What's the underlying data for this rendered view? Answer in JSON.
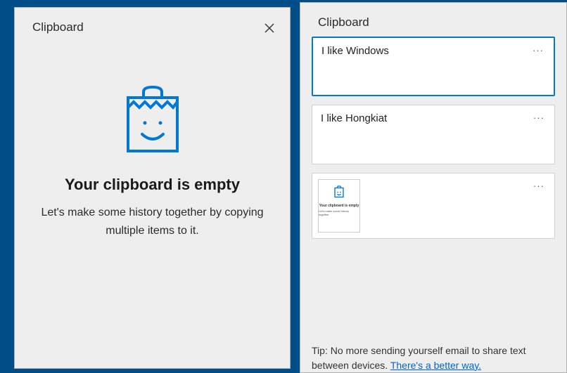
{
  "leftPanel": {
    "title": "Clipboard",
    "iconName": "clipboard-smile-icon",
    "emptyHeading": "Your clipboard is empty",
    "emptySub": "Let's make some history together by copying multiple items to it."
  },
  "rightPanel": {
    "title": "Clipboard",
    "items": [
      {
        "type": "text",
        "content": "I like Windows",
        "selected": true
      },
      {
        "type": "text",
        "content": "I like Hongkiat",
        "selected": false
      },
      {
        "type": "image",
        "thumbTitle": "Your clipboard is empty",
        "thumbSub": "Let's make some history together",
        "selected": false
      }
    ],
    "tipPrefix": "Tip: No more sending yourself email to share text between devices.  ",
    "tipLink": "There's a better way."
  },
  "colors": {
    "accent": "#0078d4",
    "bg": "#eeeeee",
    "separator": "#004d87"
  }
}
